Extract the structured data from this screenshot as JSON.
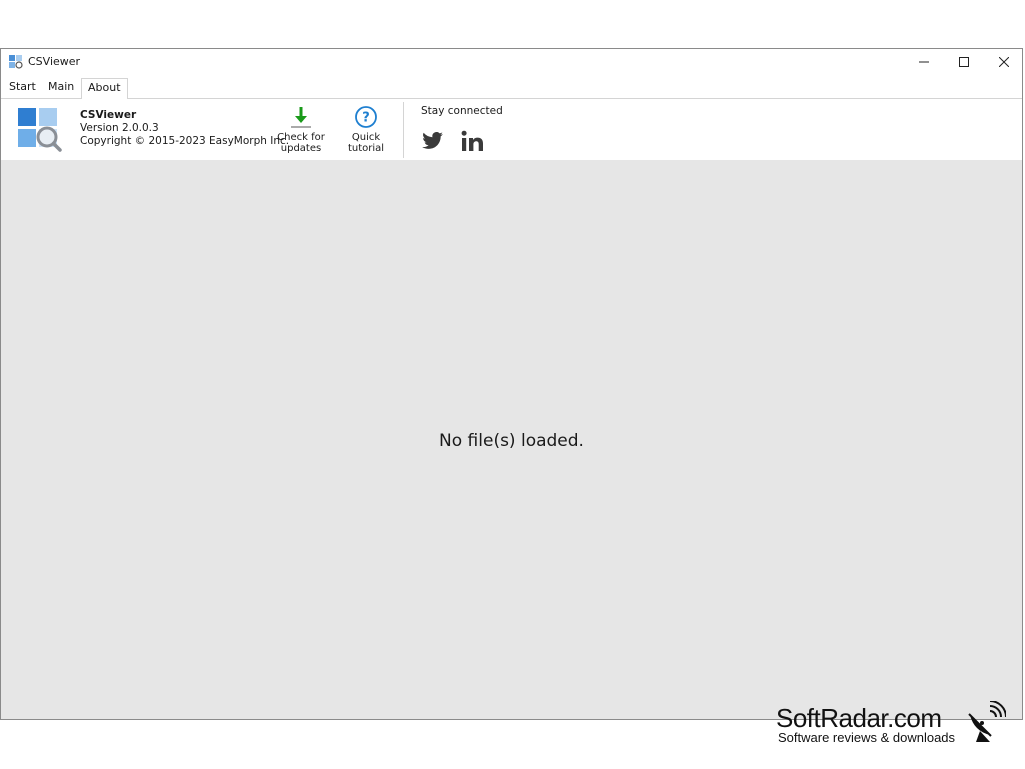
{
  "window": {
    "title": "CSViewer"
  },
  "tabs": [
    {
      "label": "Start"
    },
    {
      "label": "Main"
    },
    {
      "label": "About"
    }
  ],
  "about": {
    "app_name": "CSViewer",
    "version": "Version 2.0.0.3",
    "copyright": "Copyright © 2015-2023 EasyMorph Inc."
  },
  "ribbon": {
    "check_updates_line1": "Check for",
    "check_updates_line2": "updates",
    "quick_tutorial_line1": "Quick",
    "quick_tutorial_line2": "tutorial",
    "stay_connected": "Stay connected"
  },
  "content": {
    "empty_message": "No file(s) loaded."
  },
  "watermark": {
    "title": "SoftRadar.com",
    "subtitle": "Software reviews & downloads"
  },
  "colors": {
    "accent_blue": "#1e7fd0",
    "download_green": "#1a9a1a",
    "content_bg": "#e6e6e6"
  }
}
